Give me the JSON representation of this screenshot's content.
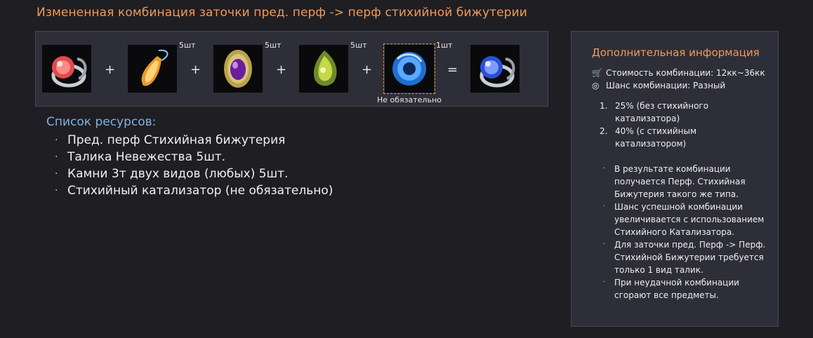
{
  "title": "Измененная комбинация заточки пред. перф -> перф стихийной бижутерии",
  "combo": {
    "slots": [
      {
        "icon": "red-gem-ring-icon",
        "qty": ""
      },
      {
        "icon": "orange-talisman-icon",
        "qty": "5шт"
      },
      {
        "icon": "purple-gem-icon",
        "qty": "5шт"
      },
      {
        "icon": "green-gem-icon",
        "qty": "5шт"
      },
      {
        "icon": "blue-catalyst-icon",
        "qty": "1шт"
      },
      {
        "icon": "blue-gem-ring-icon",
        "qty": ""
      }
    ],
    "plus": "+",
    "equals": "=",
    "optional_label": "Не обязательно"
  },
  "resources": {
    "title": "Список ресурсов:",
    "items": [
      "Пред. перф Стихийная бижутерия",
      "Талика Невежества 5шт.",
      "Камни 3т двух видов (любых) 5шт.",
      "Стихийный катализатор (не обязательно)"
    ]
  },
  "info": {
    "title": "Дополнительная информация",
    "cost": "Стоимость комбинации: 12кк~36кк",
    "chance": "Шанс комбинации: Разный",
    "chances": [
      {
        "n": "1.",
        "text": "25% (без стихийного катализатора)"
      },
      {
        "n": "2.",
        "text": "40% (с стихийным катализатором)"
      }
    ],
    "notes": [
      "В результате комбинации получается Перф. Стихийная Бижутерия такого же типа.",
      "Шанс успешной комбинации увеличивается с использованием Стихийного Катализатора.",
      "Для заточки пред. Перф -> Перф. Стихийной Бижутерии требуется только 1 вид талик.",
      "При неудачной комбинации сгорают все предметы."
    ]
  },
  "colors": {
    "accent": "#f39a55",
    "link": "#7fb3e4",
    "panel": "#2e2e38",
    "bg": "#1f1e23"
  }
}
